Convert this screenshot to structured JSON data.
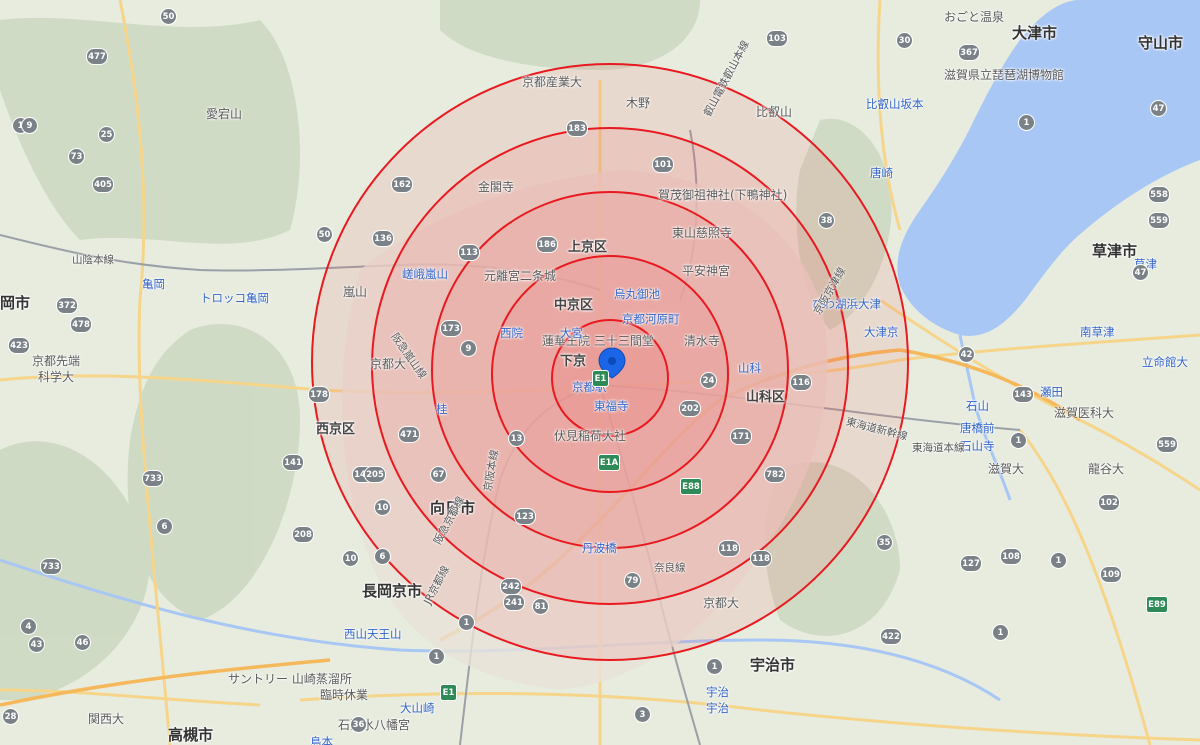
{
  "map": {
    "center_marker": "location-pin-icon",
    "radius_rings": [
      1,
      2,
      3,
      4,
      5
    ],
    "colors": {
      "ring_stroke": "#e8191f",
      "ring_fill": "#f25c5c",
      "lake": "#a8c7f5",
      "pin": "#1a66e6",
      "shield": "#7a8288",
      "station_text": "#3264c8"
    }
  },
  "labels": {
    "cities": [
      {
        "id": "otsu",
        "text": "大津市"
      },
      {
        "id": "moriyama",
        "text": "守山市"
      },
      {
        "id": "kusatsu",
        "text": "草津市"
      },
      {
        "id": "takatsuki",
        "text": "高槻市"
      },
      {
        "id": "nagaokakyo",
        "text": "長岡京市"
      },
      {
        "id": "muko",
        "text": "向日市"
      },
      {
        "id": "uji",
        "text": "宇治市"
      },
      {
        "id": "okashi",
        "text": "岡市"
      }
    ],
    "wards": [
      {
        "id": "kamigyo",
        "text": "上京区"
      },
      {
        "id": "nakagyo",
        "text": "中京区"
      },
      {
        "id": "shimogyo",
        "text": "下京"
      },
      {
        "id": "yamashina",
        "text": "山科区"
      },
      {
        "id": "nishikyo",
        "text": "西京区"
      }
    ],
    "pois": [
      {
        "id": "atagoyama",
        "text": "愛宕山"
      },
      {
        "id": "hieizan",
        "text": "比叡山"
      },
      {
        "id": "arashiyama",
        "text": "嵐山"
      },
      {
        "id": "kinkakuji",
        "text": "金閣寺"
      },
      {
        "id": "kamo",
        "text": "賀茂御祖神社(下鴨神社)"
      },
      {
        "id": "ginkakuji",
        "text": "東山慈照寺"
      },
      {
        "id": "nijo",
        "text": "元離宮二条城"
      },
      {
        "id": "heian",
        "text": "平安神宮"
      },
      {
        "id": "kiyomizu",
        "text": "清水寺"
      },
      {
        "id": "sanjusangendo",
        "text": "蓮華王院 三十三間堂"
      },
      {
        "id": "fushimi",
        "text": "伏見稲荷大社"
      },
      {
        "id": "kyoto_sangyo",
        "text": "京都産業大"
      },
      {
        "id": "kyoto_dai",
        "text": "京都大"
      },
      {
        "id": "kyoto_dai2",
        "text": "京都大"
      },
      {
        "id": "kyoto_senkyo",
        "text": "京都先端"
      },
      {
        "id": "kagaku",
        "text": "科学大"
      },
      {
        "id": "ogoto",
        "text": "おごと温泉"
      },
      {
        "id": "biwako_museum",
        "text": "滋賀県立琵琶湖博物館"
      },
      {
        "id": "shiga_med",
        "text": "滋賀医科大"
      },
      {
        "id": "shiga_dai",
        "text": "滋賀大"
      },
      {
        "id": "ryukoku",
        "text": "龍谷大"
      },
      {
        "id": "kansai_dai",
        "text": "関西大"
      },
      {
        "id": "suntory",
        "text": "サントリー 山崎蒸溜所"
      },
      {
        "id": "suntory_sub",
        "text": "臨時休業"
      },
      {
        "id": "iwashimizu",
        "text": "石清水八幡宮"
      },
      {
        "id": "kitano",
        "text": "木野"
      }
    ],
    "stations": [
      {
        "id": "kameoka",
        "text": "亀岡"
      },
      {
        "id": "torokko",
        "text": "トロッコ亀岡"
      },
      {
        "id": "sagaarashiyama",
        "text": "嵯峨嵐山"
      },
      {
        "id": "karasuma_oike",
        "text": "烏丸御池"
      },
      {
        "id": "kawaramachi",
        "text": "京都河原町"
      },
      {
        "id": "omiya",
        "text": "大宮"
      },
      {
        "id": "saiin",
        "text": "西院"
      },
      {
        "id": "kyoto_st",
        "text": "京都駅"
      },
      {
        "id": "tofukuji",
        "text": "東福寺"
      },
      {
        "id": "yamashina_st",
        "text": "山科"
      },
      {
        "id": "katsura",
        "text": "桂"
      },
      {
        "id": "tambabashi",
        "text": "丹波橋"
      },
      {
        "id": "nishiyama",
        "text": "西山天王山"
      },
      {
        "id": "oyamazaki",
        "text": "大山崎"
      },
      {
        "id": "uji_st",
        "text": "宇治"
      },
      {
        "id": "uji_st2",
        "text": "宇治"
      },
      {
        "id": "ishiyamadera",
        "text": "石山寺"
      },
      {
        "id": "ishiyama",
        "text": "石山"
      },
      {
        "id": "setakami",
        "text": "唐橋前"
      },
      {
        "id": "zeze",
        "text": "瀬田"
      },
      {
        "id": "minamikusatsu",
        "text": "南草津"
      },
      {
        "id": "kusatsu_st",
        "text": "草津"
      },
      {
        "id": "otsukyo",
        "text": "大津京"
      },
      {
        "id": "biwako_hamaotsu",
        "text": "びわ湖浜大津"
      },
      {
        "id": "karasaki",
        "text": "唐崎"
      },
      {
        "id": "hieizan_sakamoto",
        "text": "比叡山坂本"
      },
      {
        "id": "ritsumeikan",
        "text": "立命館大"
      },
      {
        "id": "shimamoto",
        "text": "島本"
      }
    ],
    "rails": [
      {
        "id": "sanin",
        "text": "山陰本線"
      },
      {
        "id": "eizan",
        "text": "叡山電鉄叡山本線"
      },
      {
        "id": "tokaido",
        "text": "東海道新幹線"
      },
      {
        "id": "hankyu",
        "text": "阪急京都線"
      },
      {
        "id": "jr_kyoto",
        "text": "JR京都線"
      },
      {
        "id": "keihan",
        "text": "京阪本線"
      },
      {
        "id": "nara",
        "text": "奈良線"
      },
      {
        "id": "hankyu_arashiyama",
        "text": "阪急嵐山線"
      },
      {
        "id": "keihan_keishin",
        "text": "京阪京津線"
      },
      {
        "id": "higashi",
        "text": "東海道本線"
      }
    ],
    "routes": [
      "50",
      "477",
      "25",
      "73",
      "405",
      "1",
      "136",
      "162",
      "50",
      "9",
      "372",
      "478",
      "423",
      "178",
      "141",
      "733",
      "6",
      "733",
      "46",
      "43",
      "4",
      "140",
      "205",
      "67",
      "10",
      "208",
      "6",
      "10",
      "471",
      "9",
      "173",
      "113",
      "186",
      "183",
      "101",
      "38",
      "103",
      "30",
      "367",
      "1",
      "47",
      "558",
      "47",
      "559",
      "42",
      "143",
      "1",
      "559",
      "102",
      "1",
      "108",
      "109",
      "1",
      "422",
      "1",
      "3",
      "242",
      "241",
      "81",
      "79",
      "123",
      "13",
      "24",
      "202",
      "171",
      "116",
      "118",
      "118",
      "35",
      "36",
      "127",
      "782",
      "1",
      "1",
      "28",
      "E1",
      "E1",
      "E1A",
      "E88",
      "E89",
      "E1",
      "1"
    ]
  }
}
